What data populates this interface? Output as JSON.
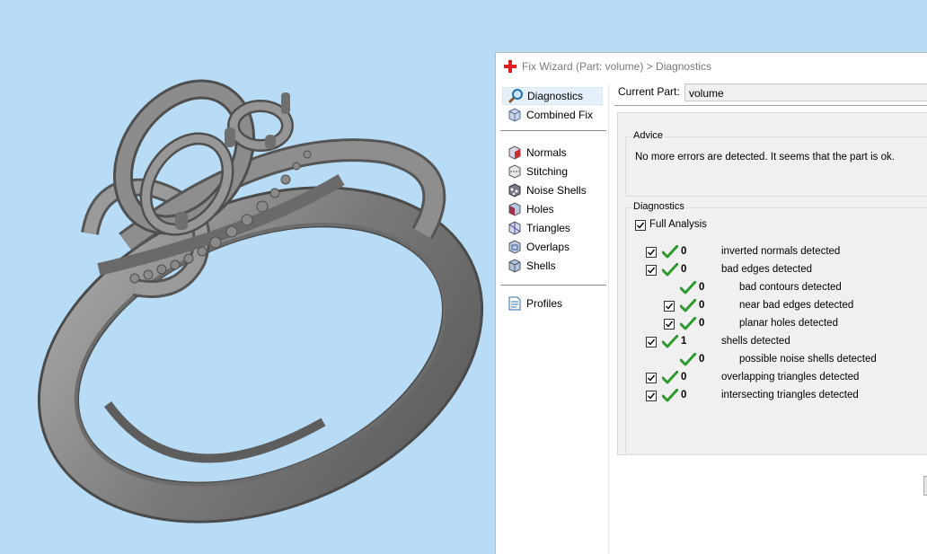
{
  "window": {
    "title": "Fix Wizard (Part: volume) > Diagnostics"
  },
  "nav": {
    "top_items": [
      {
        "label": "Diagnostics",
        "icon": "magnifier-icon",
        "selected": true
      },
      {
        "label": "Combined Fix",
        "icon": "combined-fix-cube-icon"
      }
    ],
    "fix_items": [
      {
        "label": "Normals",
        "icon": "normals-cube-icon"
      },
      {
        "label": "Stitching",
        "icon": "stitching-cube-icon"
      },
      {
        "label": "Noise Shells",
        "icon": "noise-shells-cube-icon"
      },
      {
        "label": "Holes",
        "icon": "holes-cube-icon"
      },
      {
        "label": "Triangles",
        "icon": "triangles-cube-icon"
      },
      {
        "label": "Overlaps",
        "icon": "overlaps-cube-icon"
      },
      {
        "label": "Shells",
        "icon": "shells-cube-icon"
      }
    ],
    "bottom_items": [
      {
        "label": "Profiles",
        "icon": "profiles-document-icon"
      }
    ]
  },
  "content": {
    "current_part_label": "Current Part:",
    "current_part_value": "volume",
    "advice": {
      "title": "Advice",
      "text": "No more errors are detected. It seems that the part is ok."
    },
    "diagnostics": {
      "title": "Diagnostics",
      "full_analysis_label": "Full Analysis",
      "full_analysis_checked": true,
      "rows": [
        {
          "count": "0",
          "label": "inverted normals detected",
          "checked": true
        },
        {
          "count": "0",
          "label": "bad edges detected",
          "checked": true
        },
        {
          "count": "0",
          "label": "bad contours detected",
          "checkbox": false
        },
        {
          "count": "0",
          "label": "near bad edges detected",
          "checked": true
        },
        {
          "count": "0",
          "label": "planar holes detected",
          "checked": true
        },
        {
          "count": "1",
          "label": "shells detected",
          "checked": true
        },
        {
          "count": "0",
          "label": "possible noise shells detected",
          "checkbox": false
        },
        {
          "count": "0",
          "label": "overlapping triangles detected",
          "checked": true
        },
        {
          "count": "0",
          "label": "intersecting triangles detected",
          "checked": true
        }
      ]
    }
  },
  "colors": {
    "viewport_background": "#b9dcf6",
    "model_gray": "#7d7d7d",
    "ok_tick_green": "#2e9a2e",
    "title_icon_red": "#e02020"
  }
}
